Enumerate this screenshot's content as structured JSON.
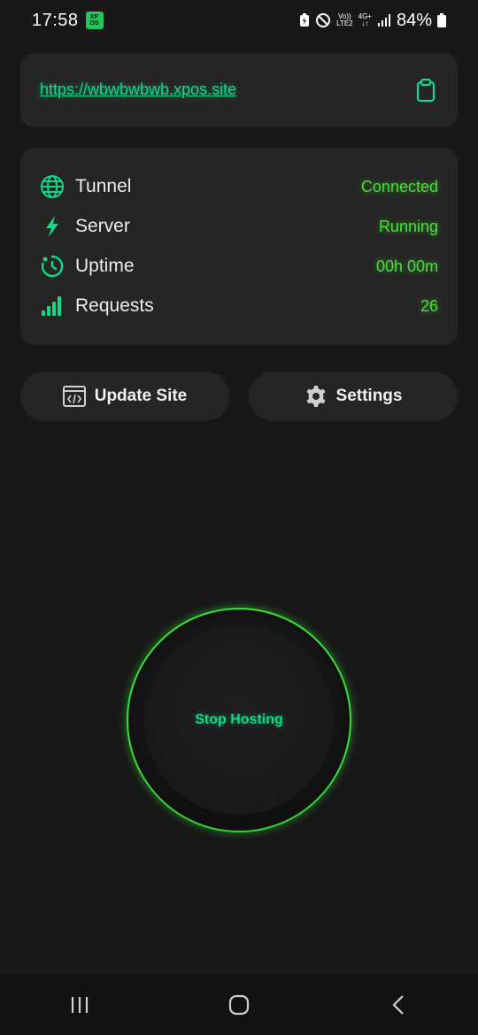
{
  "status_bar": {
    "time": "17:58",
    "app_badge": "XP OS",
    "volte_top": "Vo))",
    "volte_bottom": "LTE2",
    "net_top": "4G+",
    "net_bottom": "↓↑",
    "battery": "84%"
  },
  "site": {
    "url": "https://wbwbwbwb.xpos.site",
    "copy_icon": "clipboard-icon"
  },
  "stats": [
    {
      "icon": "globe-icon",
      "label": "Tunnel",
      "value": "Connected"
    },
    {
      "icon": "bolt-icon",
      "label": "Server",
      "value": "Running"
    },
    {
      "icon": "timer-icon",
      "label": "Uptime",
      "value": "00h 00m"
    },
    {
      "icon": "signal-bars-icon",
      "label": "Requests",
      "value": "26"
    }
  ],
  "actions": {
    "update_label": "Update Site",
    "settings_label": "Settings"
  },
  "host_button": {
    "label": "Stop Hosting"
  },
  "colors": {
    "accent_green": "#4ade3a",
    "accent_teal": "#10d98a",
    "card_bg": "#252525",
    "page_bg": "#181818"
  }
}
